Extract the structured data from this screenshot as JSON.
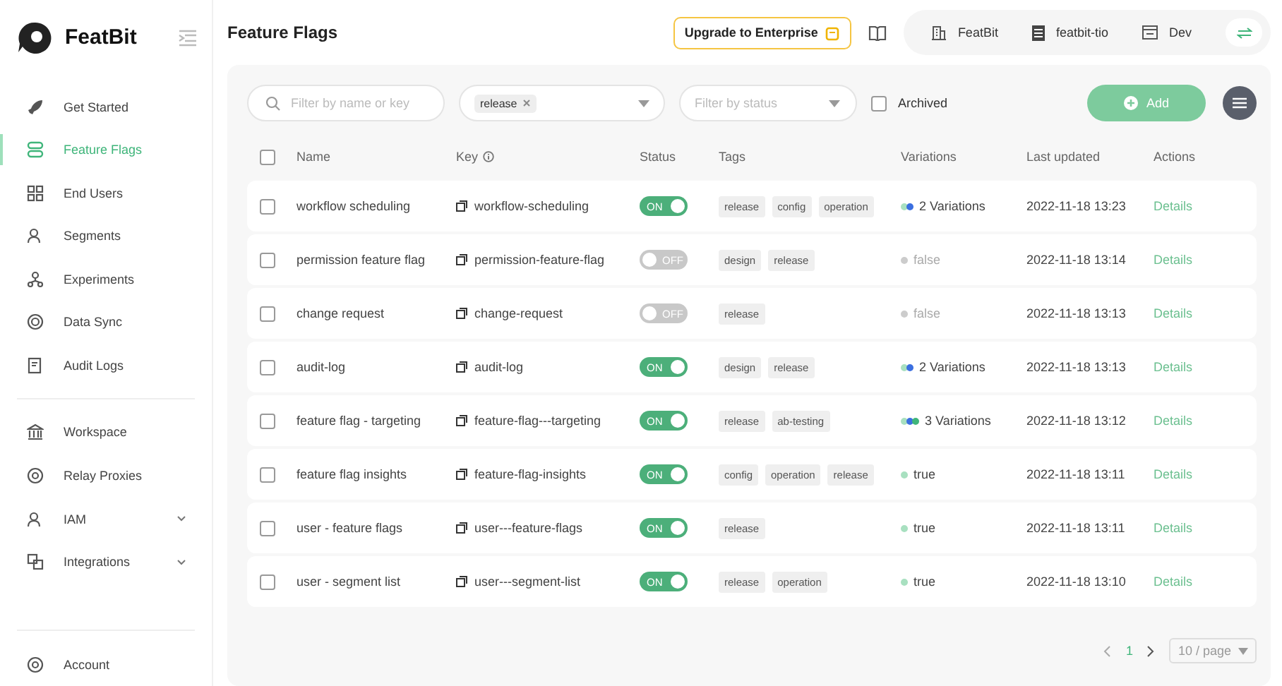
{
  "brand": {
    "name": "FeatBit"
  },
  "sidebar": {
    "sections": [
      {
        "items": [
          {
            "label": "Get Started",
            "selected": false,
            "expandable": false
          },
          {
            "label": "Feature Flags",
            "selected": true,
            "expandable": false
          },
          {
            "label": "End Users",
            "selected": false,
            "expandable": false
          },
          {
            "label": "Segments",
            "selected": false,
            "expandable": false
          },
          {
            "label": "Experiments",
            "selected": false,
            "expandable": false
          },
          {
            "label": "Data Sync",
            "selected": false,
            "expandable": false
          },
          {
            "label": "Audit Logs",
            "selected": false,
            "expandable": false
          }
        ]
      },
      {
        "items": [
          {
            "label": "Workspace",
            "selected": false,
            "expandable": false
          },
          {
            "label": "Relay Proxies",
            "selected": false,
            "expandable": false
          },
          {
            "label": "IAM",
            "selected": false,
            "expandable": true
          },
          {
            "label": "Integrations",
            "selected": false,
            "expandable": true
          }
        ]
      },
      {
        "items": [
          {
            "label": "Account",
            "selected": false,
            "expandable": false
          }
        ]
      }
    ]
  },
  "header": {
    "title": "Feature Flags",
    "upgrade": "Upgrade to Enterprise",
    "organization": "FeatBit",
    "project": "featbit-tio",
    "environment": "Dev"
  },
  "filters": {
    "search": {
      "placeholder": "Filter by name or key"
    },
    "tags": {
      "chips": [
        "release"
      ]
    },
    "status": {
      "placeholder": "Filter by status"
    },
    "archived": {
      "label": "Archived",
      "checked": false
    },
    "add_button": "Add"
  },
  "table": {
    "all_checked": false,
    "columns": [
      "Name",
      "Key",
      "Status",
      "Tags",
      "Variations",
      "Last updated",
      "Actions"
    ],
    "rows": [
      {
        "checked": false,
        "name": "workflow scheduling",
        "key": "workflow-scheduling",
        "on": true,
        "status_label": "ON",
        "tags": [
          "release",
          "config",
          "operation"
        ],
        "variation": {
          "dots": [
            {
              "color": "#a8e0c0"
            },
            {
              "color": "#3b6fe0"
            }
          ],
          "label": "2 Variations"
        },
        "updated": "2022-11-18 13:23",
        "action": "Details"
      },
      {
        "checked": false,
        "name": "permission feature flag",
        "key": "permission-feature-flag",
        "on": false,
        "status_label": "OFF",
        "tags": [
          "design",
          "release"
        ],
        "variation": {
          "dots": [
            {
              "color": "#cccccc"
            }
          ],
          "label": "false"
        },
        "updated": "2022-11-18 13:14",
        "action": "Details"
      },
      {
        "checked": false,
        "name": "change request",
        "key": "change-request",
        "on": false,
        "status_label": "OFF",
        "tags": [
          "release"
        ],
        "variation": {
          "dots": [
            {
              "color": "#cccccc"
            }
          ],
          "label": "false"
        },
        "updated": "2022-11-18 13:13",
        "action": "Details"
      },
      {
        "checked": false,
        "name": "audit-log",
        "key": "audit-log",
        "on": true,
        "status_label": "ON",
        "tags": [
          "design",
          "release"
        ],
        "variation": {
          "dots": [
            {
              "color": "#a8e0c0"
            },
            {
              "color": "#3b6fe0"
            }
          ],
          "label": "2 Variations"
        },
        "updated": "2022-11-18 13:13",
        "action": "Details"
      },
      {
        "checked": false,
        "name": "feature flag - targeting",
        "key": "feature-flag---targeting",
        "on": true,
        "status_label": "ON",
        "tags": [
          "release",
          "ab-testing"
        ],
        "variation": {
          "dots": [
            {
              "color": "#a8e0c0"
            },
            {
              "color": "#3b6fe0"
            },
            {
              "color": "#3fb57a"
            }
          ],
          "label": "3 Variations"
        },
        "updated": "2022-11-18 13:12",
        "action": "Details"
      },
      {
        "checked": false,
        "name": "feature flag insights",
        "key": "feature-flag-insights",
        "on": true,
        "status_label": "ON",
        "tags": [
          "config",
          "operation",
          "release"
        ],
        "variation": {
          "dots": [
            {
              "color": "#a8e0c0"
            }
          ],
          "label": "true"
        },
        "updated": "2022-11-18 13:11",
        "action": "Details"
      },
      {
        "checked": false,
        "name": "user - feature flags",
        "key": "user---feature-flags",
        "on": true,
        "status_label": "ON",
        "tags": [
          "release"
        ],
        "variation": {
          "dots": [
            {
              "color": "#a8e0c0"
            }
          ],
          "label": "true"
        },
        "updated": "2022-11-18 13:11",
        "action": "Details"
      },
      {
        "checked": false,
        "name": "user - segment list",
        "key": "user---segment-list",
        "on": true,
        "status_label": "ON",
        "tags": [
          "release",
          "operation"
        ],
        "variation": {
          "dots": [
            {
              "color": "#a8e0c0"
            }
          ],
          "label": "true"
        },
        "updated": "2022-11-18 13:10",
        "action": "Details"
      }
    ]
  },
  "pagination": {
    "pages": [
      {
        "label": "1",
        "selected": true
      }
    ],
    "page_size": "10 / page"
  }
}
